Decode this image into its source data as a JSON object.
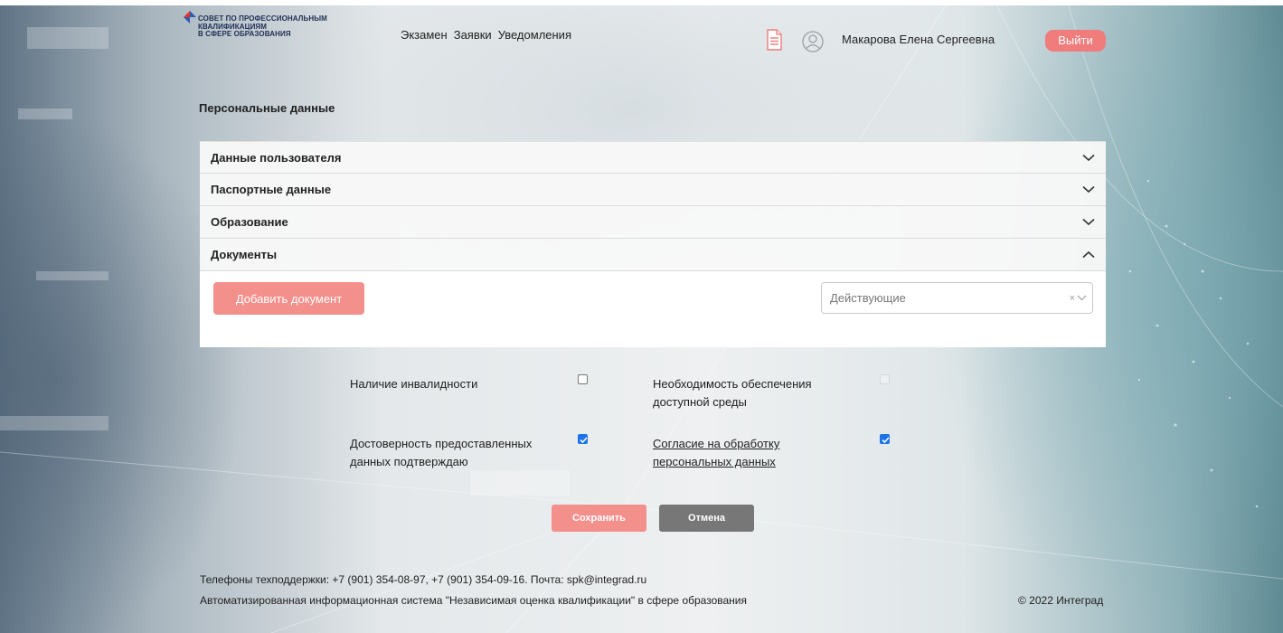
{
  "header": {
    "logo_lines": [
      "СОВЕТ ПО ПРОФЕССИОНАЛЬНЫМ",
      "КВАЛИФИКАЦИЯМ",
      "В СФЕРЕ ОБРАЗОВАНИЯ"
    ],
    "nav": [
      "Экзамен",
      "Заявки",
      "Уведомления"
    ],
    "user_name": "Макарова Елена Сергеевна",
    "logout_label": "Выйти",
    "doc_icon": "document-icon",
    "user_icon": "user-avatar-icon"
  },
  "page": {
    "title": "Персональные данные"
  },
  "accordion": [
    {
      "title": "Данные пользователя",
      "expanded": false
    },
    {
      "title": "Паспортные данные",
      "expanded": false
    },
    {
      "title": "Образование",
      "expanded": false
    },
    {
      "title": "Документы",
      "expanded": true
    }
  ],
  "documents": {
    "add_label": "Добавить документ",
    "filter_value": "Действующие",
    "clear_glyph": "×"
  },
  "fields": {
    "disability_label": "Наличие инвалидности",
    "disability_checked": false,
    "accessible_env_label": [
      "Необходимость обеспечения",
      "доступной среды"
    ],
    "accessible_env_checked": false,
    "accessible_env_disabled": true,
    "accuracy_label": [
      "Достоверность предоставленных",
      "данных подтверждаю"
    ],
    "accuracy_checked": true,
    "consent_label": [
      "Согласие на обработку",
      "персональных данных"
    ],
    "consent_checked": true
  },
  "actions": {
    "save_label": "Сохранить",
    "cancel_label": "Отмена"
  },
  "footer": {
    "support": "Телефоны техподдержки: +7 (901) 354-08-97, +7 (901) 354-09-16. Почта: spk@integrad.ru",
    "system": "Автоматизированная информационная система \"Независимая оценка квалификации\" в сфере образования",
    "copyright": "© 2022 Интеград"
  },
  "colors": {
    "accent": "#f07c7c",
    "button_pink": "#f4908c",
    "cancel_gray": "#777777",
    "checkbox_blue": "#1a73e8"
  }
}
